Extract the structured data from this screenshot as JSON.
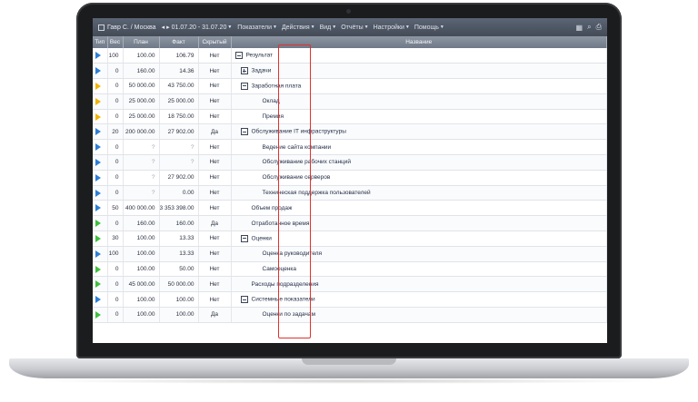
{
  "header": {
    "user": "Гавр С. / Москва",
    "period": "01.07.20 - 31.07.20",
    "menus": [
      "Показатели",
      "Действия",
      "Вид",
      "Отчёты",
      "Настройки",
      "Помощь"
    ]
  },
  "columns": [
    "Тип",
    "Вес",
    "План",
    "Факт",
    "Скрытый",
    "Название"
  ],
  "colors": {
    "blue_flag": "#2d7fd6",
    "yellow_flag": "#f2b400",
    "green_flag": "#3fbf3f",
    "highlight": "#e0312c"
  },
  "rows": [
    {
      "flag": "blue",
      "weight": "100",
      "plan": "100.00",
      "fact": "106.79",
      "hidden": "Нет",
      "name": "Результат",
      "indent": 0,
      "tree": "minus"
    },
    {
      "flag": "blue",
      "weight": "0",
      "plan": "160.00",
      "fact": "14.36",
      "hidden": "Нет",
      "name": "Задачи",
      "indent": 1,
      "tree": "plus"
    },
    {
      "flag": "yellow",
      "weight": "0",
      "plan": "50 000.00",
      "fact": "43 750.00",
      "hidden": "Нет",
      "name": "Заработная плата",
      "indent": 1,
      "tree": "minus"
    },
    {
      "flag": "yellow",
      "weight": "0",
      "plan": "25 000.00",
      "fact": "25 000.00",
      "hidden": "Нет",
      "name": "Оклад",
      "indent": 3,
      "tree": ""
    },
    {
      "flag": "yellow",
      "weight": "0",
      "plan": "25 000.00",
      "fact": "18 750.00",
      "hidden": "Нет",
      "name": "Премия",
      "indent": 3,
      "tree": ""
    },
    {
      "flag": "blue",
      "weight": "20",
      "plan": "200 000.00",
      "fact": "27 902.00",
      "hidden": "Да",
      "name": "Обслуживание IT инфраструктуры",
      "indent": 1,
      "tree": "minus"
    },
    {
      "flag": "blue",
      "weight": "0",
      "plan": "?",
      "fact": "?",
      "hidden": "Нет",
      "name": "Ведение сайта компании",
      "indent": 3,
      "tree": ""
    },
    {
      "flag": "blue",
      "weight": "0",
      "plan": "?",
      "fact": "?",
      "hidden": "Нет",
      "name": "Обслуживание рабочих станций",
      "indent": 3,
      "tree": ""
    },
    {
      "flag": "blue",
      "weight": "0",
      "plan": "?",
      "fact": "27 902.00",
      "hidden": "Нет",
      "name": "Обслуживание серверов",
      "indent": 3,
      "tree": ""
    },
    {
      "flag": "blue",
      "weight": "0",
      "plan": "?",
      "fact": "0.00",
      "hidden": "Нет",
      "name": "Техническая поддержка пользователей",
      "indent": 3,
      "tree": ""
    },
    {
      "flag": "blue",
      "weight": "50",
      "plan": "400 000.00",
      "fact": "3 353 398.00",
      "hidden": "Нет",
      "name": "Объем продаж",
      "indent": 2,
      "tree": ""
    },
    {
      "flag": "green",
      "weight": "0",
      "plan": "160.00",
      "fact": "160.00",
      "hidden": "Да",
      "name": "Отработанное время",
      "indent": 2,
      "tree": ""
    },
    {
      "flag": "green",
      "weight": "30",
      "plan": "100.00",
      "fact": "13.33",
      "hidden": "Нет",
      "name": "Оценки",
      "indent": 1,
      "tree": "minus"
    },
    {
      "flag": "blue",
      "weight": "100",
      "plan": "100.00",
      "fact": "13.33",
      "hidden": "Нет",
      "name": "Оценка руководителя",
      "indent": 3,
      "tree": ""
    },
    {
      "flag": "green",
      "weight": "0",
      "plan": "100.00",
      "fact": "50.00",
      "hidden": "Нет",
      "name": "Самооценка",
      "indent": 3,
      "tree": ""
    },
    {
      "flag": "green",
      "weight": "0",
      "plan": "45 000.00",
      "fact": "50 000.00",
      "hidden": "Нет",
      "name": "Расходы подразделения",
      "indent": 2,
      "tree": ""
    },
    {
      "flag": "blue",
      "weight": "0",
      "plan": "100.00",
      "fact": "100.00",
      "hidden": "Нет",
      "name": "Системные показатели",
      "indent": 1,
      "tree": "minus"
    },
    {
      "flag": "green",
      "weight": "0",
      "plan": "100.00",
      "fact": "100.00",
      "hidden": "Да",
      "name": "Оценки по задачам",
      "indent": 3,
      "tree": ""
    }
  ]
}
